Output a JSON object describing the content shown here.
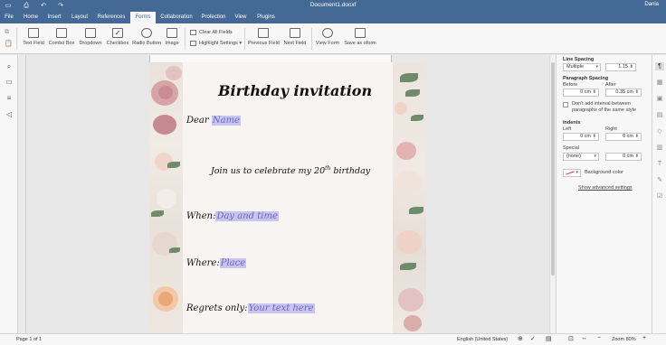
{
  "titlebar": {
    "document_title": "Document1.docxf",
    "user": "Dania",
    "icons": [
      "save-icon",
      "print-icon",
      "undo-icon",
      "redo-icon"
    ]
  },
  "menu": {
    "tabs": [
      "File",
      "Home",
      "Insert",
      "Layout",
      "References",
      "Forms",
      "Collaboration",
      "Protection",
      "View",
      "Plugins"
    ],
    "active": "Forms"
  },
  "toolbar": {
    "text_field": "Text Field",
    "combo_box": "Combo Box",
    "dropdown": "Dropdown",
    "checkbox": "Checkbox",
    "radio_button": "Radio Button",
    "image": "Image",
    "clear_all_fields": "Clear All Fields",
    "highlight_settings": "Highlight Settings",
    "previous_field": "Previous Field",
    "next_field": "Next Field",
    "view_form": "View Form",
    "save_as_oform": "Save as oform"
  },
  "document": {
    "title": "Birthday invitation",
    "dear_label": "Dear ",
    "name_field": "Name",
    "join_text": "Join us to celebrate my 20",
    "join_sup": "th",
    "join_end": " birthday",
    "when_label": "When:",
    "when_field": "Day and time",
    "where_label": "Where:",
    "where_field": "Place",
    "regrets_label": "Regrets only:",
    "regrets_field": "Your text here"
  },
  "panel": {
    "line_spacing": "Line Spacing",
    "line_spacing_type": "Multiple",
    "line_spacing_value": "1.15",
    "paragraph_spacing": "Paragraph Spacing",
    "before": "Before",
    "after": "After",
    "before_value": "0 cm",
    "after_value": "0.35 cm",
    "dont_add_interval_1": "Don't add interval between",
    "dont_add_interval_2": "paragraphs of the same style",
    "indents": "Indents",
    "left": "Left",
    "right": "Right",
    "left_value": "0 cm",
    "right_value": "0 cm",
    "special": "Special",
    "special_value": "(none)",
    "special_amount": "0 cm",
    "background_color": "Background color",
    "show_advanced": "Show advanced settings"
  },
  "statusbar": {
    "page": "Page 1 of 1",
    "language": "English (United States)",
    "zoom": "Zoom 80%"
  },
  "colors": {
    "brand": "#446995",
    "field_highlight": "#c7c4f0"
  }
}
